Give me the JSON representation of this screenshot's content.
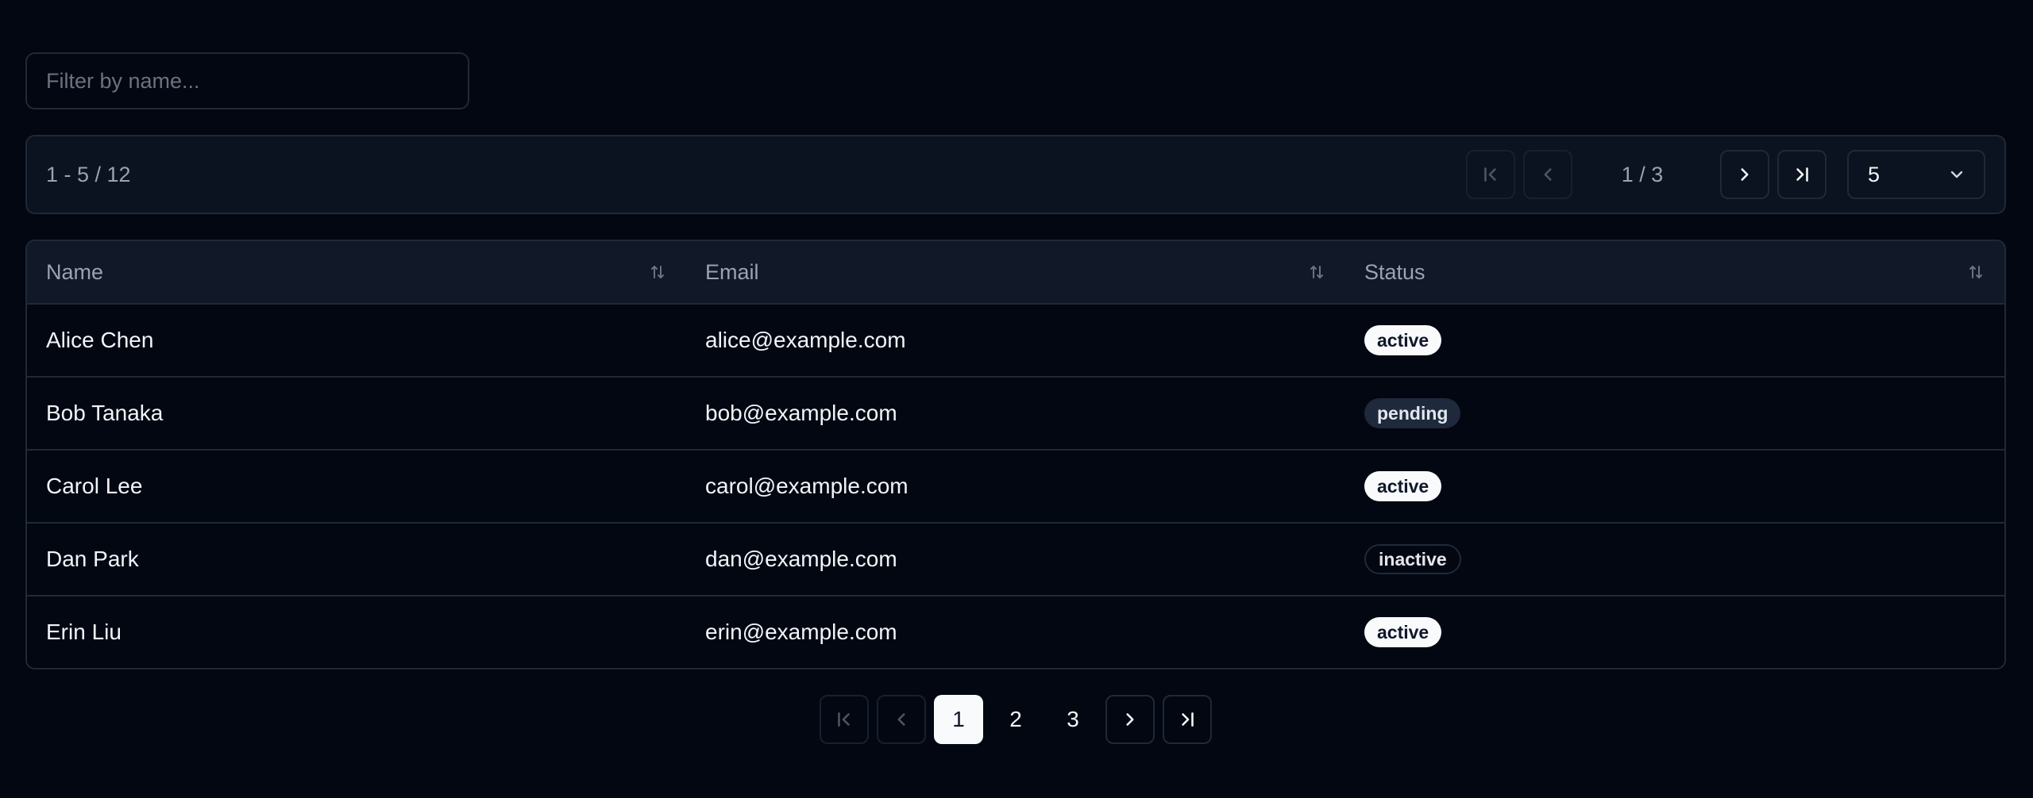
{
  "filter": {
    "placeholder": "Filter by name..."
  },
  "toolbar": {
    "range": "1 - 5 / 12",
    "page_indicator": "1 / 3",
    "page_size": "5"
  },
  "table": {
    "columns": [
      "Name",
      "Email",
      "Status"
    ],
    "rows": [
      {
        "name": "Alice Chen",
        "email": "alice@example.com",
        "status": "active"
      },
      {
        "name": "Bob Tanaka",
        "email": "bob@example.com",
        "status": "pending"
      },
      {
        "name": "Carol Lee",
        "email": "carol@example.com",
        "status": "active"
      },
      {
        "name": "Dan Park",
        "email": "dan@example.com",
        "status": "inactive"
      },
      {
        "name": "Erin Liu",
        "email": "erin@example.com",
        "status": "active"
      }
    ]
  },
  "pager": {
    "pages": [
      "1",
      "2",
      "3"
    ],
    "current": "1"
  },
  "icons": {
    "first": "chevrons-first-icon",
    "prev": "chevron-left-icon",
    "next": "chevron-right-icon",
    "last": "chevrons-last-icon",
    "sort": "sort-arrows-icon",
    "dropdown": "chevron-down-icon"
  },
  "colors": {
    "background": "#030712",
    "border": "#1f2937",
    "header_bg": "#111827",
    "active_badge": "#f8fafc",
    "pending_badge": "#1e293b"
  }
}
